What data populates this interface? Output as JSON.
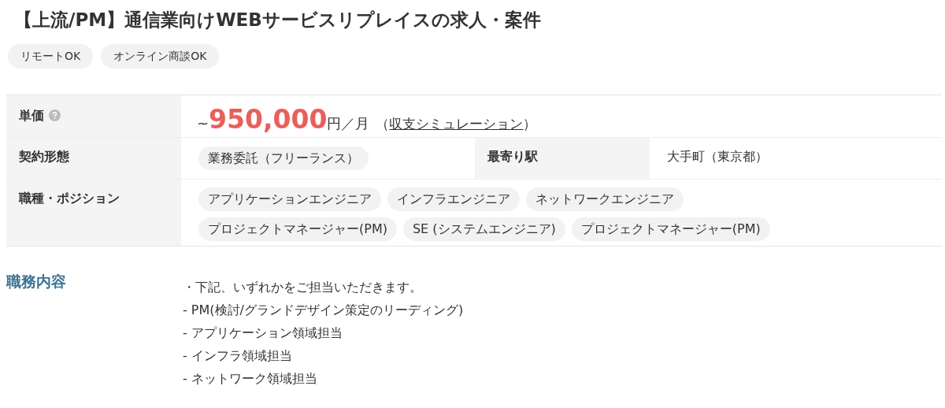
{
  "title": "【上流/PM】通信業向けWEBサービスリプレイスの求人・案件",
  "tags": [
    "リモートOK",
    "オンライン商談OK"
  ],
  "price": {
    "label": "単価",
    "prefix": "~",
    "amount": "950,000",
    "unit": "円／月",
    "paren_open": "（",
    "link": "収支シミュレーション",
    "paren_close": "）"
  },
  "contract": {
    "label": "契約形態",
    "tags": [
      "業務委託（フリーランス）"
    ],
    "station_label": "最寄り駅",
    "station": "大手町（東京都）"
  },
  "positions": {
    "label": "職種・ポジション",
    "tags": [
      "アプリケーションエンジニア",
      "インフラエンジニア",
      "ネットワークエンジニア",
      "プロジェクトマネージャー(PM)",
      "SE (システムエンジニア)",
      "プロジェクトマネージャー(PM)"
    ]
  },
  "duties": {
    "label": "職務内容",
    "lines": [
      "・下記、いずれかをご担当いただきます。",
      "- PM(検討/グランドデザイン策定のリーディング)",
      "- アプリケーション領域担当",
      "- インフラ領域担当",
      "- ネットワーク領域担当"
    ]
  }
}
